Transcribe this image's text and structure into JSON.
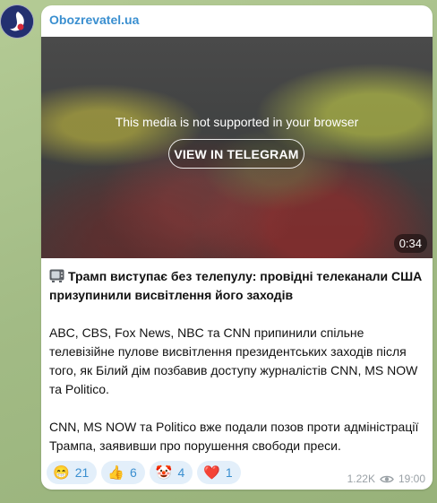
{
  "channel": {
    "name": "Obozrevatel.ua"
  },
  "media": {
    "unsupported_text": "This media is not supported in your browser",
    "view_button": "VIEW IN TELEGRAM",
    "duration": "0:34"
  },
  "post": {
    "headline": "Трамп виступає без телепулу: провідні телеканали США призупинили висвітлення його заходів",
    "paragraph1": "ABC, CBS, Fox News, NBC та CNN припинили спільне телевізійне пулове висвітлення президентських заходів після того, як Білий дім позбавив доступу журналістів CNN, MS NOW та Politico.",
    "paragraph2": "CNN, MS NOW та Politico вже подали позов проти адміністрації Трампа, заявивши про порушення свободи преси."
  },
  "reactions": [
    {
      "emoji": "😁",
      "count": "21"
    },
    {
      "emoji": "👍",
      "count": "6"
    },
    {
      "emoji": "🤡",
      "count": "4"
    },
    {
      "emoji": "❤️",
      "count": "1"
    }
  ],
  "meta": {
    "views": "1.22K",
    "time": "19:00"
  },
  "icons": {
    "headline": "tv-icon",
    "views": "eye-icon"
  },
  "colors": {
    "accent": "#3a8fd0",
    "reaction_bg": "#e3effa",
    "bubble": "#ffffff"
  }
}
